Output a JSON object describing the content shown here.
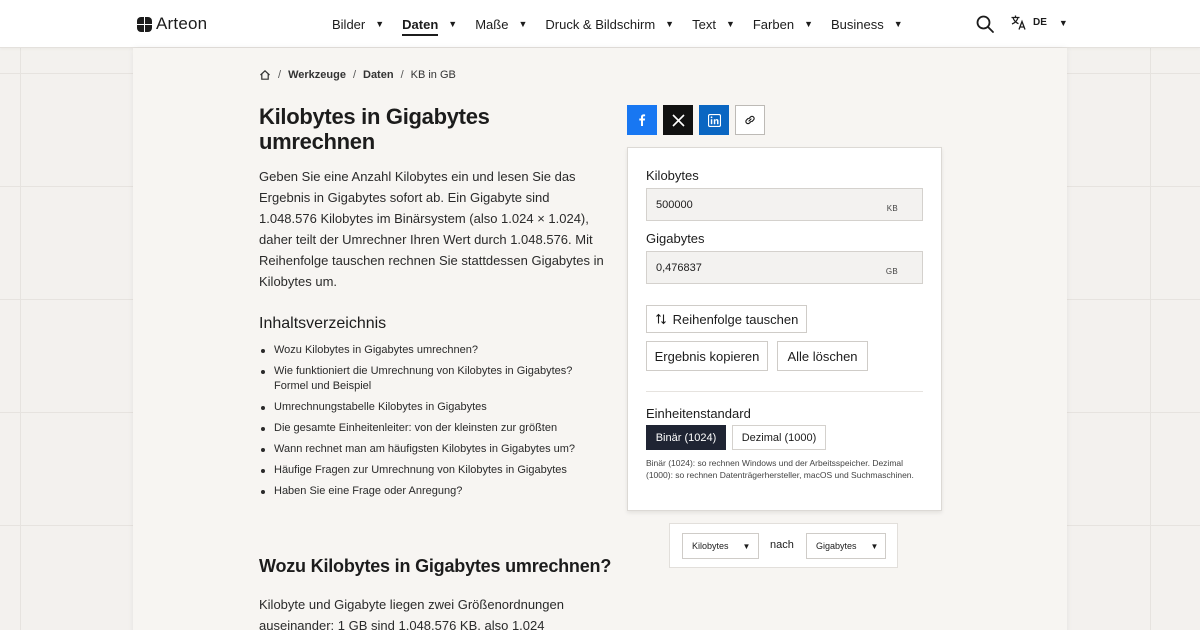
{
  "header": {
    "logo_text": "Arteon",
    "nav": [
      {
        "label": "Bilder",
        "active": false
      },
      {
        "label": "Daten",
        "active": true
      },
      {
        "label": "Maße",
        "active": false
      },
      {
        "label": "Druck & Bildschirm",
        "active": false
      },
      {
        "label": "Text",
        "active": false
      },
      {
        "label": "Farben",
        "active": false
      },
      {
        "label": "Business",
        "active": false
      }
    ],
    "caret": "▼",
    "lang": "DE"
  },
  "breadcrumb": {
    "sep": "/",
    "items": [
      "Werkzeuge",
      "Daten",
      "KB in GB"
    ]
  },
  "article": {
    "title": "Kilobytes in Gigabytes umrechnen",
    "intro": "Geben Sie eine Anzahl Kilobytes ein und lesen Sie das Ergebnis in Gigabytes sofort ab. Ein Gigabyte sind 1.048.576 Kilobytes im Binärsystem (also 1.024 × 1.024), daher teilt der Umrechner Ihren Wert durch 1.048.576. Mit Reihenfolge tauschen rechnen Sie stattdessen Gigabytes in Kilobytes um.",
    "toc_title": "Inhaltsverzeichnis",
    "toc": [
      "Wozu Kilobytes in Gigabytes umrechnen?",
      "Wie funktioniert die Umrechnung von Kilobytes in Gigabytes? Formel und Beispiel",
      "Umrechnungstabelle Kilobytes in Gigabytes",
      "Die gesamte Einheitenleiter: von der kleinsten zur größten",
      "Wann rechnet man am häufigsten Kilobytes in Gigabytes um?",
      "Häufige Fragen zur Umrechnung von Kilobytes in Gigabytes",
      "Haben Sie eine Frage oder Anregung?"
    ],
    "section_title": "Wozu Kilobytes in Gigabytes umrechnen?",
    "section_text": "Kilobyte und Gigabyte liegen zwei Größenordnungen auseinander: 1 GB sind 1.048.576 KB, also 1.024"
  },
  "converter": {
    "from_label": "Kilobytes",
    "from_value": "500000",
    "from_unit": "KB",
    "to_label": "Gigabytes",
    "to_value": "0,476837",
    "to_unit": "GB",
    "swap_label": "Reihenfolge tauschen",
    "copy_label": "Ergebnis kopieren",
    "clear_label": "Alle löschen",
    "standard_label": "Einheitenstandard",
    "binary_label": "Binär (1024)",
    "decimal_label": "Dezimal (1000)",
    "hint": "Binär (1024): so rechnen Windows und der Arbeitsspeicher. Dezimal (1000): so rechnen Datenträgerhersteller, macOS und Suchmaschinen."
  },
  "unit_selector": {
    "from": "Kilobytes",
    "connector": "nach",
    "to": "Gigabytes"
  },
  "colors": {
    "facebook": "#1877f2",
    "x": "#111111",
    "linkedin": "#0a66c2",
    "active_segment": "#1f2433"
  }
}
